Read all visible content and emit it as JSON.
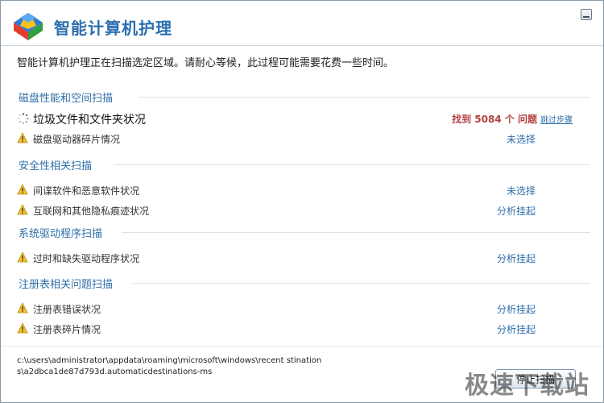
{
  "window": {
    "title": "智能计算机护理",
    "intro": "智能计算机护理正在扫描选定区域。请耐心等候，此过程可能需要花费一些时间。"
  },
  "sections": [
    {
      "title": "磁盘性能和空间扫描",
      "main_item": {
        "label": "垃圾文件和文件夹状况",
        "found_text": "找到 5084 个 问题",
        "link": "跳过步骤"
      },
      "items": [
        {
          "label": "磁盘驱动器碎片情况",
          "status": "未选择"
        }
      ]
    },
    {
      "title": "安全性相关扫描",
      "items": [
        {
          "label": "间谍软件和恶意软件状况",
          "status": "未选择"
        },
        {
          "label": "互联网和其他隐私痕迹状况",
          "status": "分析挂起"
        }
      ]
    },
    {
      "title": "系统驱动程序扫描",
      "items": [
        {
          "label": "过时和缺失驱动程序状况",
          "status": "分析挂起"
        }
      ]
    },
    {
      "title": "注册表相关问题扫描",
      "items": [
        {
          "label": "注册表错误状况",
          "status": "分析挂起"
        },
        {
          "label": "注册表碎片情况",
          "status": "分析挂起"
        }
      ]
    }
  ],
  "footer": {
    "path": "c:\\users\\administrator\\appdata\\roaming\\microsoft\\windows\\recent stinations\\a2dbca1de87d793d.automaticdestinations-ms",
    "stop_button": "停止扫描"
  },
  "watermark": "极速下载站",
  "icons": {
    "logo": "app-logo-icon",
    "warning": "warning-icon",
    "spinner": "loading-spinner-icon",
    "minimize": "minimize-icon"
  },
  "colors": {
    "title": "#2b6fb0",
    "section": "#2f6ea8",
    "status": "#2f6ea8",
    "found": "#b34040"
  }
}
